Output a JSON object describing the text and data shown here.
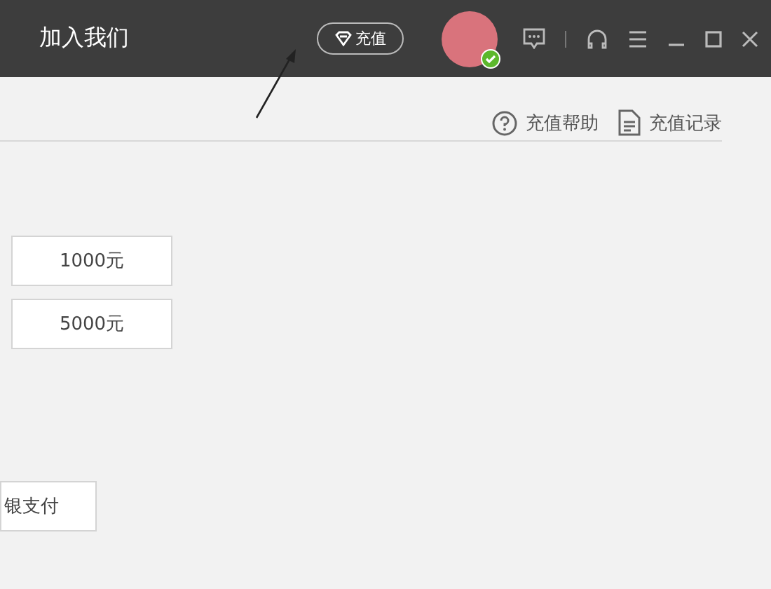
{
  "header": {
    "title": "加入我们",
    "recharge_button": "充值",
    "avatar": {
      "online": true
    }
  },
  "links": [
    {
      "kind": "help",
      "label": "充值帮助"
    },
    {
      "kind": "record",
      "label": "充值记录"
    }
  ],
  "amounts": [
    "1000元",
    "5000元"
  ],
  "payment_button": "银支付"
}
